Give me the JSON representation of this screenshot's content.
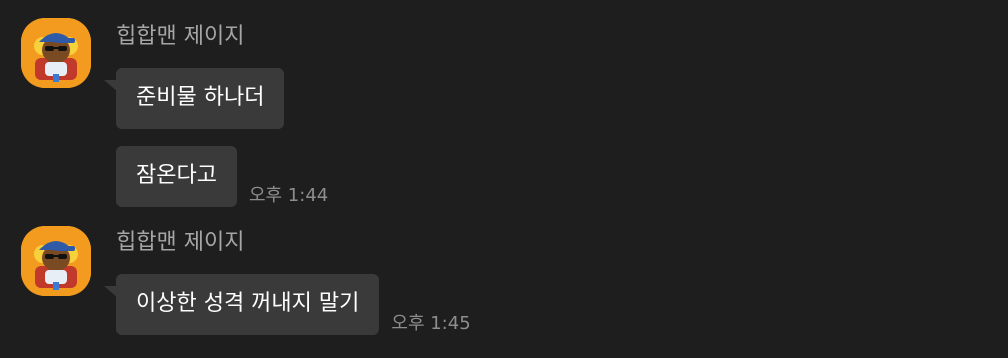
{
  "messages": [
    {
      "sender": "힙합맨 제이지",
      "bubbles": [
        {
          "text": "준비물 하나더",
          "time": ""
        },
        {
          "text": "잠온다고",
          "time": "오후 1:44"
        }
      ]
    },
    {
      "sender": "힙합맨 제이지",
      "bubbles": [
        {
          "text": "이상한 성격 꺼내지 말기",
          "time": "오후 1:45"
        }
      ]
    }
  ],
  "colors": {
    "background": "#1e1e1e",
    "bubble": "#3a3a3a",
    "avatar_bg": "#f29b1f",
    "sender_text": "#a6a6a6",
    "time_text": "#8d8d8d"
  },
  "icons": {
    "avatar": "jay-g-character-avatar-icon"
  }
}
